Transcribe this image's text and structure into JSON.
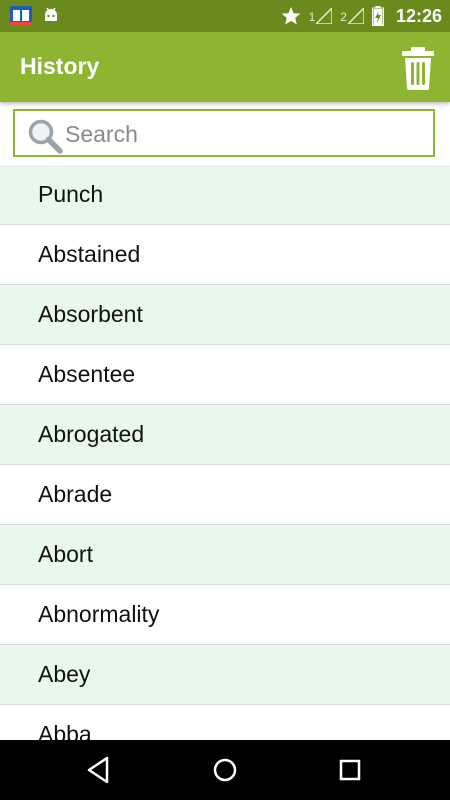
{
  "status_bar": {
    "time": "12:26",
    "sim1": "1",
    "sim2": "2",
    "icons": [
      "dictionary-app-icon",
      "android-debug-icon",
      "star-icon",
      "signal-icon",
      "battery-charging-icon"
    ]
  },
  "app_bar": {
    "title": "History",
    "delete_icon": "trash-icon"
  },
  "search": {
    "placeholder": "Search",
    "value": ""
  },
  "history": {
    "items": [
      "Punch",
      "Abstained",
      "Absorbent",
      "Absentee",
      "Abrogated",
      "Abrade",
      "Abort",
      "Abnormality",
      "Abey",
      "Abba"
    ]
  },
  "nav_bar": {
    "icons": [
      "back-icon",
      "home-icon",
      "recents-icon"
    ]
  },
  "colors": {
    "status_bar": "#6b8a1e",
    "app_bar": "#8db532",
    "row_alt": "#e8f8e9"
  }
}
